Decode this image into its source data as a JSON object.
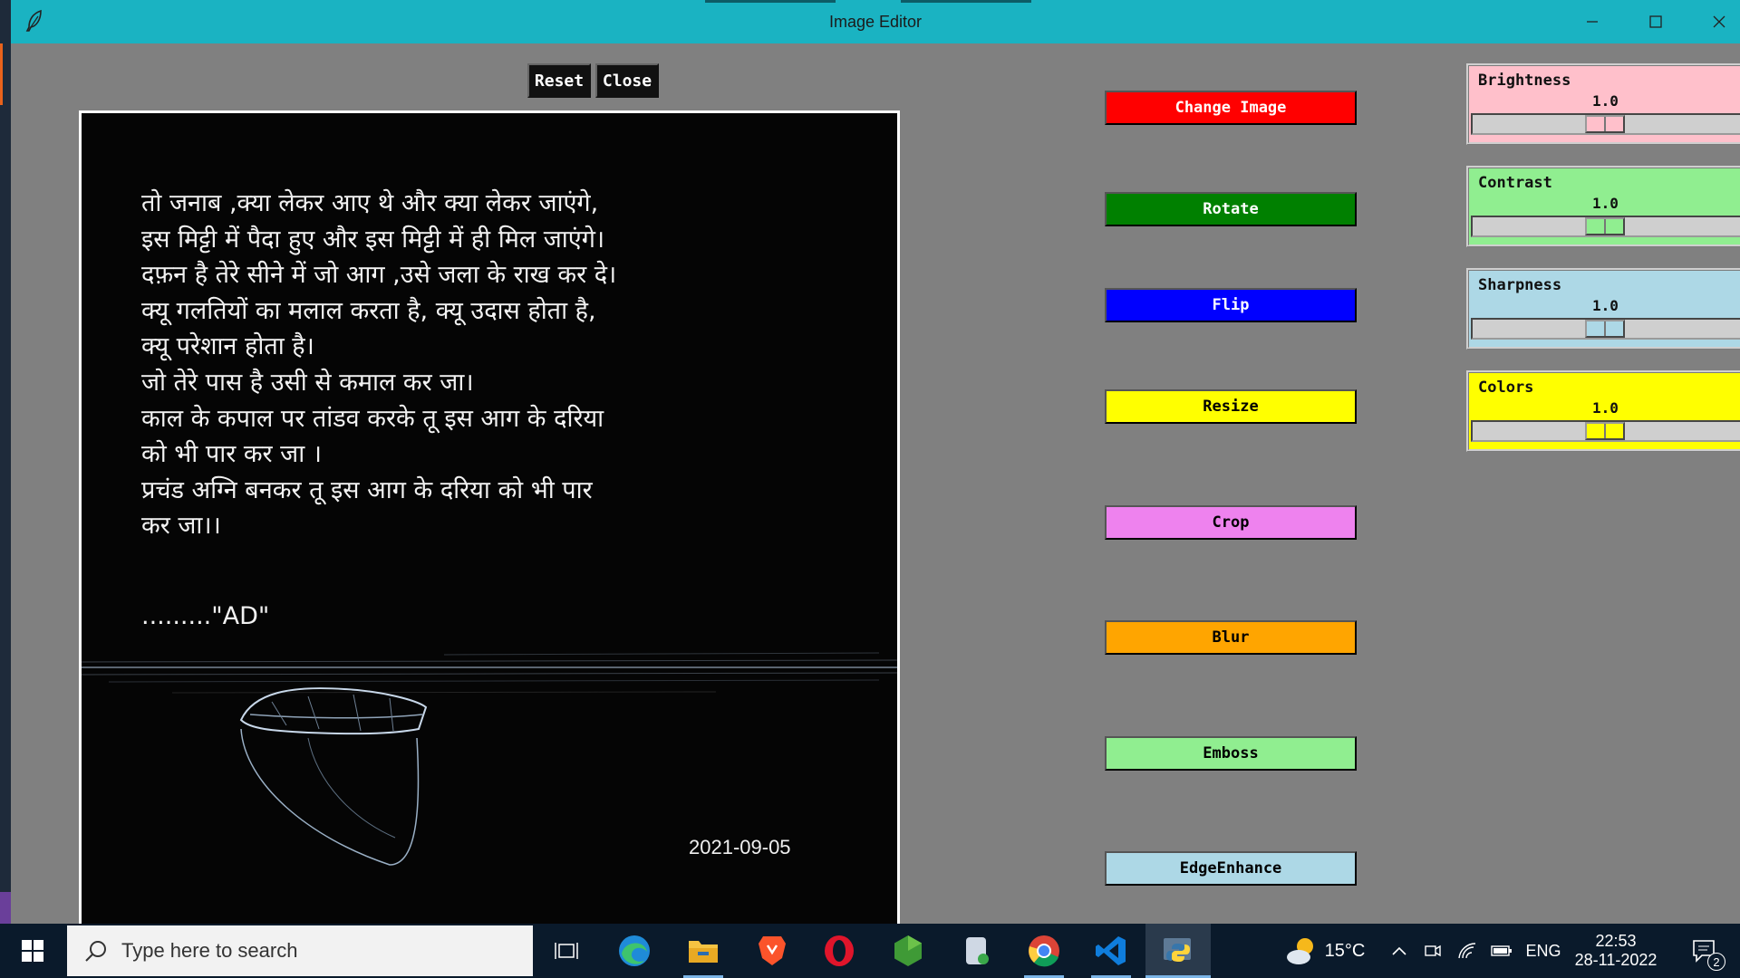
{
  "window": {
    "title": "Image Editor",
    "minimize_glyph": "—",
    "maximize_glyph": "☐",
    "close_glyph": "✕"
  },
  "toolbar": {
    "reset_label": "Reset",
    "close_label": "Close"
  },
  "image": {
    "poem_lines": [
      "तो जनाब ,क्या लेकर आए थे और क्या लेकर जाएंगे,",
      "इस मिट्टी में पैदा हुए और इस मिट्टी में ही मिल जाएंगे।",
      "दफ़न है तेरे सीने में जो आग ,उसे जला के राख कर दे।",
      "क्यू गलतियों का मलाल करता है, क्यू उदास होता है,",
      "क्यू परेशान होता है।",
      "जो तेरे पास है उसी से कमाल कर जा।",
      "काल के कपाल पर तांडव करके तू इस आग के दरिया",
      "को भी पार कर जा ।",
      "प्रचंड अग्नि बनकर तू इस आग के दरिया को भी पार",
      "कर जा।।"
    ],
    "signature": ".........\"AD\"",
    "date": "2021-09-05"
  },
  "actions": [
    {
      "label": "Change Image",
      "bg": "#ff0000",
      "fg": "#ffffff"
    },
    {
      "label": "Rotate",
      "bg": "#008000",
      "fg": "#ffffff"
    },
    {
      "label": "Flip",
      "bg": "#0000ff",
      "fg": "#ffffff"
    },
    {
      "label": "Resize",
      "bg": "#ffff00",
      "fg": "#000000"
    },
    {
      "label": "Crop",
      "bg": "#ee82ee",
      "fg": "#000000"
    },
    {
      "label": "Blur",
      "bg": "#ffa500",
      "fg": "#000000"
    },
    {
      "label": "Emboss",
      "bg": "#90ee90",
      "fg": "#000000"
    },
    {
      "label": "EdgeEnhance",
      "bg": "#add8e6",
      "fg": "#000000"
    }
  ],
  "sliders": [
    {
      "label": "Brightness",
      "value": "1.0",
      "bg": "#ffc0cb"
    },
    {
      "label": "Contrast",
      "value": "1.0",
      "bg": "#90ee90"
    },
    {
      "label": "Sharpness",
      "value": "1.0",
      "bg": "#add8e6"
    },
    {
      "label": "Colors",
      "value": "1.0",
      "bg": "#ffff00"
    }
  ],
  "taskbar": {
    "search_placeholder": "Type here to search",
    "apps": [
      "task-view-icon",
      "edge-icon",
      "file-explorer-icon",
      "brave-icon",
      "opera-icon",
      "nodejs-icon",
      "disk-app-icon",
      "chrome-icon",
      "vscode-icon",
      "python-icon"
    ],
    "weather_temp": "15°C",
    "language": "ENG",
    "time": "22:53",
    "date": "28-11-2022",
    "notification_count": "2"
  }
}
